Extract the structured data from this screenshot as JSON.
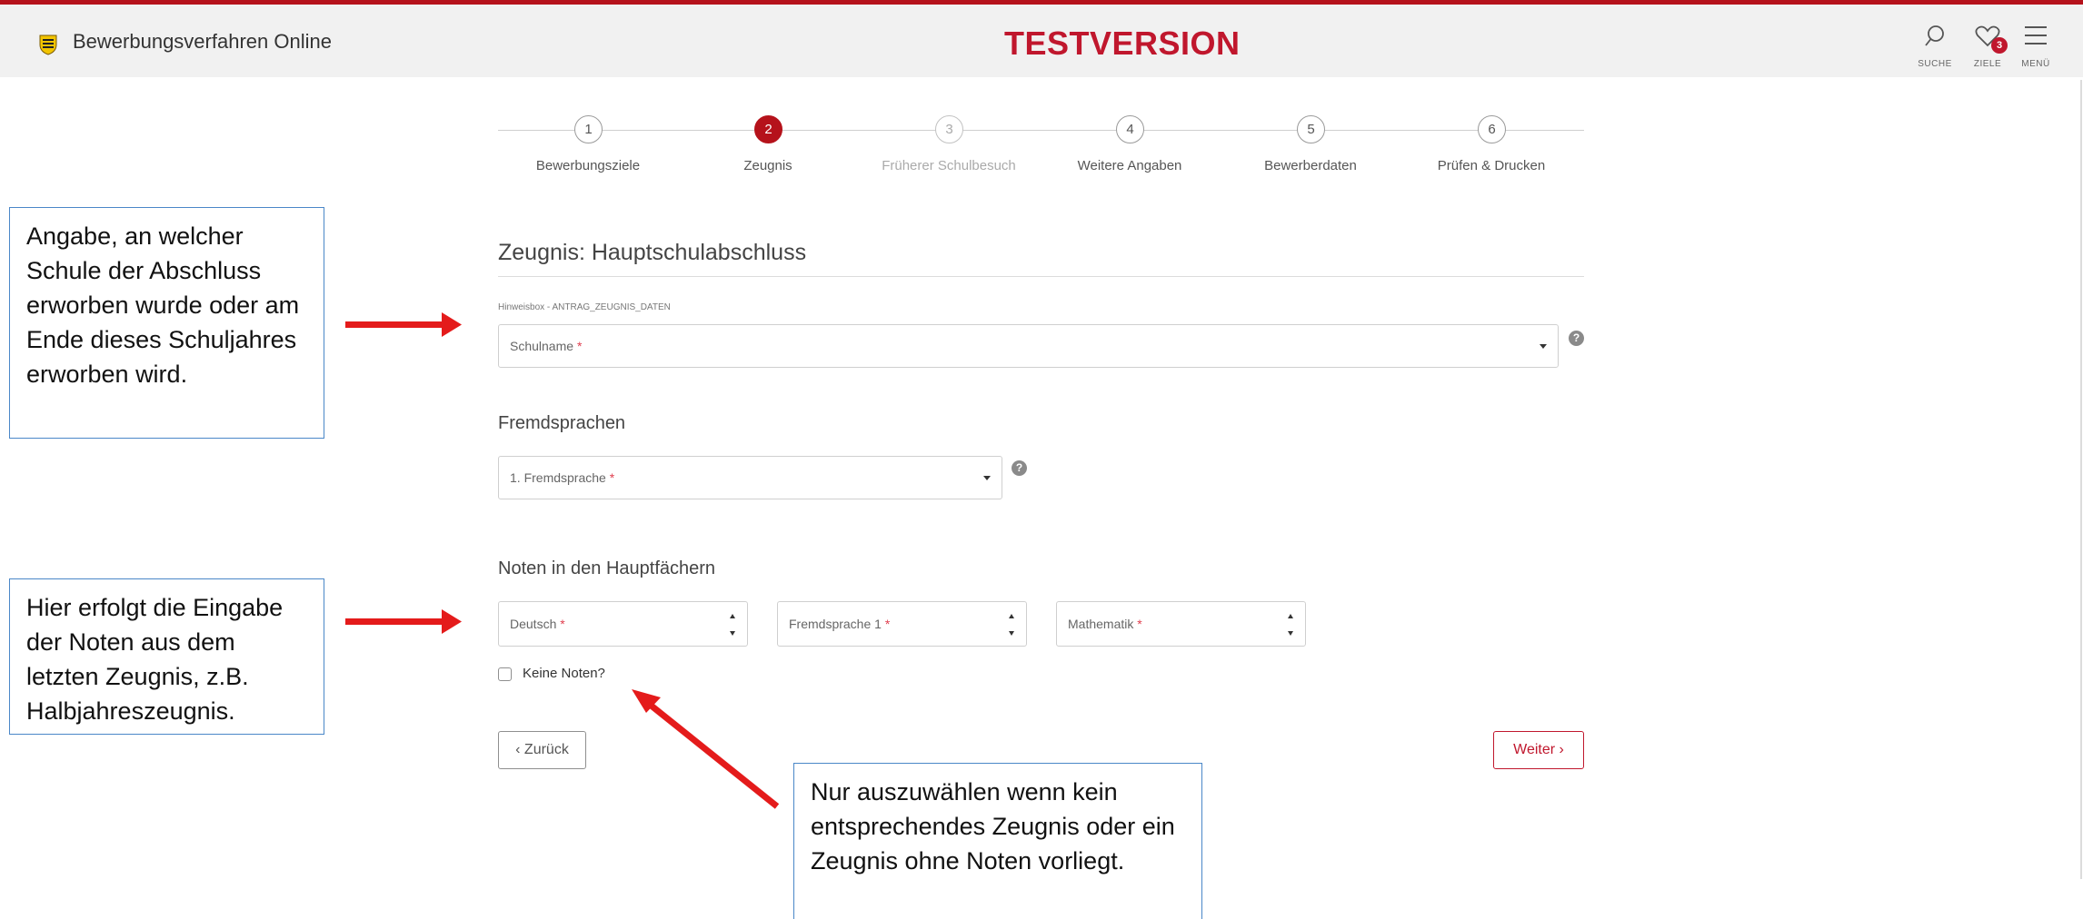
{
  "header": {
    "app_title": "Bewerbungsverfahren Online",
    "environment_label": "TESTVERSION",
    "search_label": "SUCHE",
    "goals_label": "ZIELE",
    "goals_badge": "3",
    "menu_label": "MENÜ"
  },
  "stepper": {
    "steps": [
      {
        "number": "1",
        "label": "Bewerbungsziele",
        "state": "default"
      },
      {
        "number": "2",
        "label": "Zeugnis",
        "state": "active"
      },
      {
        "number": "3",
        "label": "Früherer Schulbesuch",
        "state": "disabled"
      },
      {
        "number": "4",
        "label": "Weitere Angaben",
        "state": "default"
      },
      {
        "number": "5",
        "label": "Bewerberdaten",
        "state": "default"
      },
      {
        "number": "6",
        "label": "Prüfen & Drucken",
        "state": "default"
      }
    ]
  },
  "form": {
    "section_title": "Zeugnis: Hauptschulabschluss",
    "hint": "Hinweisbox - ANTRAG_ZEUGNIS_DATEN",
    "school_name_placeholder": "Schulname",
    "foreign_languages_heading": "Fremdsprachen",
    "foreign_language_1_placeholder": "1. Fremdsprache",
    "grades_heading": "Noten in den Hauptfächern",
    "grade_fields": [
      {
        "placeholder": "Deutsch"
      },
      {
        "placeholder": "Fremdsprache 1"
      },
      {
        "placeholder": "Mathematik"
      }
    ],
    "required_marker": "*",
    "help_glyph": "?",
    "no_grades_label": "Keine Noten?"
  },
  "navigation": {
    "back_label": "‹ Zurück",
    "next_label": "Weiter ›"
  },
  "annotations": {
    "school_note": "Angabe, an welcher Schule der Abschluss erworben wurde oder am Ende dieses Schuljahres erworben wird.",
    "grades_note": "Hier erfolgt die Eingabe der Noten aus dem letzten Zeugnis, z.B. Halbjahreszeugnis.",
    "no_grades_note": "Nur auszuwählen wenn kein entsprechendes Zeugnis oder ein Zeugnis ohne Noten vorliegt."
  },
  "colors": {
    "accent": "#b5121b",
    "test_label": "#c0172d",
    "annotation_arrow": "#e41b1b",
    "callout_border": "#4a87c8"
  }
}
